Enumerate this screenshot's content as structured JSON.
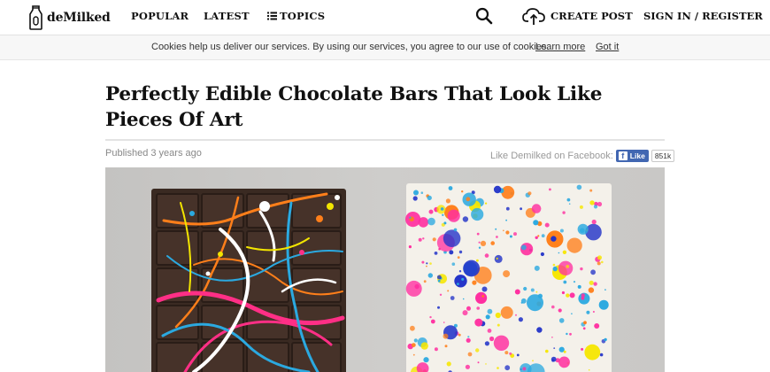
{
  "header": {
    "logo_text": "deMilked",
    "nav": {
      "popular": "POPULAR",
      "latest": "LATEST",
      "topics": "TOPICS"
    },
    "create_post": "CREATE POST",
    "signin_register": "SIGN IN / REGISTER",
    "icons": [
      "milk-bottle-icon",
      "list-icon",
      "search-icon",
      "cloud-upload-icon"
    ]
  },
  "cookie_bar": {
    "text": "Cookies help us deliver our services. By using our services, you agree to our use of cookies.",
    "learn_more": "Learn more",
    "got_it": "Got it"
  },
  "article": {
    "title": "Perfectly Edible Chocolate Bars That Look Like Pieces Of Art",
    "published": "Published 3 years ago",
    "facebook": {
      "label": "Like Demilked on Facebook:",
      "like_button": "Like",
      "count": "851k"
    }
  },
  "colors": {
    "facebook_blue": "#4267b2",
    "photo_background": "#c9c8c6",
    "chocolate": "#3a2a22"
  }
}
